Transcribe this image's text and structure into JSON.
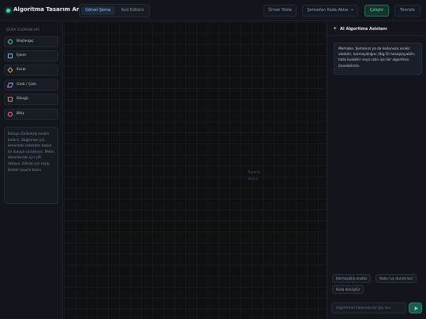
{
  "header": {
    "title": "Algoritma Tasarım Aracı",
    "tabs": [
      "Görsel Şema",
      "Kod Editörü"
    ],
    "buttons": {
      "load_example": "Örnek Yükle",
      "export_code": "Şemadan Koda Aktar →",
      "run": "Çalıştır",
      "clear": "Temizle"
    },
    "colors": {
      "accent": "#3ed3b2",
      "active_tab": "#8fc0ff"
    }
  },
  "sidebar": {
    "title": "ŞEMA ELEMANLARI",
    "blocks": [
      {
        "label": "Başlangıç",
        "icon": "circle-icon"
      },
      {
        "label": "İşlem",
        "icon": "square-icon"
      },
      {
        "label": "Karar",
        "icon": "diamond-icon"
      },
      {
        "label": "Girdi / Çıktı",
        "icon": "parallelogram-icon"
      },
      {
        "label": "Döngü",
        "icon": "dashed-square-icon"
      },
      {
        "label": "Bitiş",
        "icon": "circle-icon"
      }
    ],
    "hint": "Kutuyu sürükleyip tuvale bırakın. Bağlamak için kenardaki noktadan başka bir kutuya sürükleyin. Metni düzenlemek için çift tıklayın. Silmek için seçip Delete tuşuna basın."
  },
  "canvas": {
    "hint_line1": "Tuval b",
    "hint_line2": "akış ş"
  },
  "panel": {
    "title": "AI Algoritma Asistanı",
    "welcome": "Merhaba. Şemanızı ya da kodunuzu analiz edebilir, karmaşıklığını (Big O) hesaplayabilir, hata bulabilir veya sizin için bir algoritma önerebilirim.",
    "chips": [
      "Karmaşıklık analizi",
      "Hata / uç durum bul",
      "Koda dönüştür"
    ],
    "input_placeholder": "Algoritman hakkında bir şey sor..."
  }
}
